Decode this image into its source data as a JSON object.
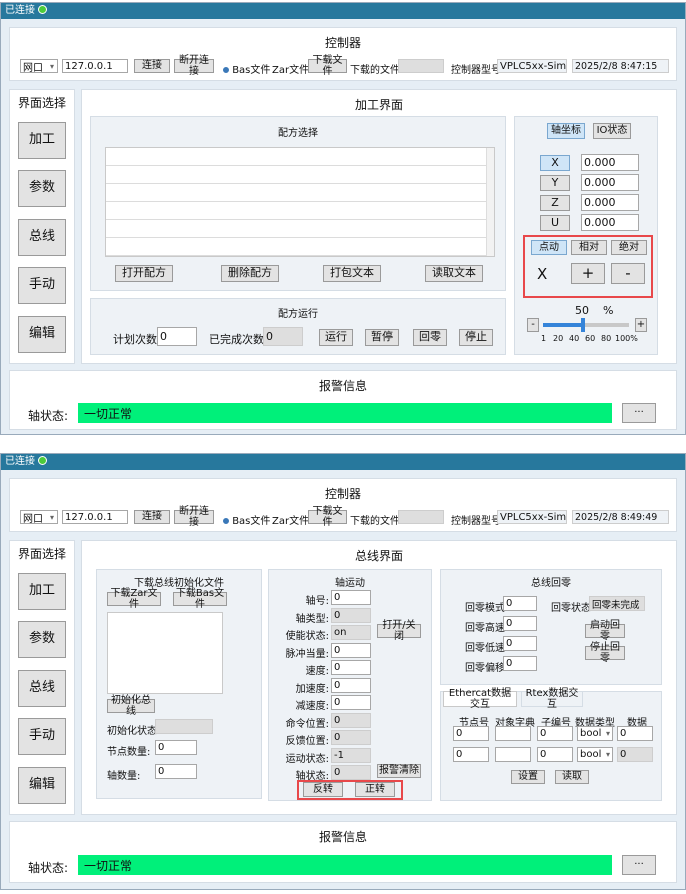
{
  "window1": {
    "status": "已连接",
    "controller": {
      "title": "控制器",
      "port": "网口",
      "ip": "127.0.0.1",
      "connect": "连接",
      "disconnect": "断开连接",
      "bas": "Bas文件",
      "zar": "Zar文件",
      "download": "下载文件",
      "downloaded_label": "下载的文件:",
      "model_label": "控制器型号:",
      "model": "VPLC5xx-Simu",
      "datetime": "2025/2/8 8:47:15"
    },
    "nav": {
      "title": "界面选择",
      "items": [
        "加工",
        "参数",
        "总线",
        "手动",
        "编辑"
      ]
    },
    "main": {
      "title": "加工界面",
      "recipe": {
        "title": "配方选择",
        "open": "打开配方",
        "delete": "删除配方",
        "pack": "打包文本",
        "read": "读取文本"
      },
      "run": {
        "title": "配方运行",
        "plan_label": "计划次数",
        "plan": "0",
        "done_label": "已完成次数",
        "done": "0",
        "start": "运行",
        "pause": "暂停",
        "home": "回零",
        "stop": "停止"
      },
      "axis": {
        "tab1": "轴坐标",
        "tab2": "IO状态",
        "axes": [
          {
            "name": "X",
            "value": "0.000"
          },
          {
            "name": "Y",
            "value": "0.000"
          },
          {
            "name": "Z",
            "value": "0.000"
          },
          {
            "name": "U",
            "value": "0.000"
          }
        ],
        "jog": "点动",
        "rel": "相对",
        "abs": "绝对",
        "selected_axis": "X",
        "plus": "+",
        "minus": "-",
        "speed": "50",
        "pct": "%",
        "dec": "-",
        "inc": "+",
        "ticks": [
          "1",
          "20",
          "40",
          "60",
          "80",
          "100%"
        ]
      }
    },
    "alarm": {
      "title": "报警信息",
      "label": "轴状态:",
      "status": "一切正常",
      "more": "···"
    }
  },
  "window2": {
    "status": "已连接",
    "controller": {
      "title": "控制器",
      "port": "网口",
      "ip": "127.0.0.1",
      "connect": "连接",
      "disconnect": "断开连接",
      "bas": "Bas文件",
      "zar": "Zar文件",
      "download": "下载文件",
      "downloaded_label": "下载的文件:",
      "model_label": "控制器型号:",
      "model": "VPLC5xx-Simu",
      "datetime": "2025/2/8 8:49:49"
    },
    "nav": {
      "title": "界面选择",
      "items": [
        "加工",
        "参数",
        "总线",
        "手动",
        "编辑"
      ]
    },
    "main": {
      "title": "总线界面",
      "init": {
        "title": "下载总线初始化文件",
        "zar": "下载Zar文件",
        "bas": "下载Bas文件",
        "init_btn": "初始化总线",
        "init_status": "初始化状态:",
        "nodes_label": "节点数量:",
        "nodes": "0",
        "axes_label": "轴数量:",
        "axes": "0"
      },
      "motion": {
        "title": "轴运动",
        "rows": [
          {
            "label": "轴号:",
            "value": "0"
          },
          {
            "label": "轴类型:",
            "value": "0"
          },
          {
            "label": "使能状态:",
            "value": "on"
          },
          {
            "label": "脉冲当量:",
            "value": "0"
          },
          {
            "label": "速度:",
            "value": "0"
          },
          {
            "label": "加速度:",
            "value": "0"
          },
          {
            "label": "减速度:",
            "value": "0"
          },
          {
            "label": "命令位置:",
            "value": "0"
          },
          {
            "label": "反馈位置:",
            "value": "0"
          },
          {
            "label": "运动状态:",
            "value": "-1"
          },
          {
            "label": "轴状态:",
            "value": "0"
          }
        ],
        "toggle": "打开/关闭",
        "clear": "报警清除",
        "reverse": "反转",
        "forward": "正转"
      },
      "homing": {
        "title": "总线回零",
        "mode_label": "回零模式:",
        "mode": "0",
        "high_label": "回零高速:",
        "high": "0",
        "low_label": "回零低速:",
        "low": "0",
        "offset_label": "回零偏移:",
        "offset": "0",
        "state_label": "回零状态:",
        "state": "回零未完成",
        "start": "启动回零",
        "stop": "停止回零"
      },
      "data": {
        "tab1": "Ethercat数据交互",
        "tab2": "Rtex数据交互",
        "headers": [
          "节点号",
          "对象字典",
          "子编号",
          "数据类型",
          "数据"
        ],
        "rows": [
          {
            "node": "0",
            "dict": "",
            "sub": "0",
            "type": "bool",
            "data": "0"
          },
          {
            "node": "0",
            "dict": "",
            "sub": "0",
            "type": "bool",
            "data": "0"
          }
        ],
        "set": "设置",
        "read": "读取"
      }
    },
    "alarm": {
      "title": "报警信息",
      "label": "轴状态:",
      "status": "一切正常",
      "more": "···"
    }
  }
}
